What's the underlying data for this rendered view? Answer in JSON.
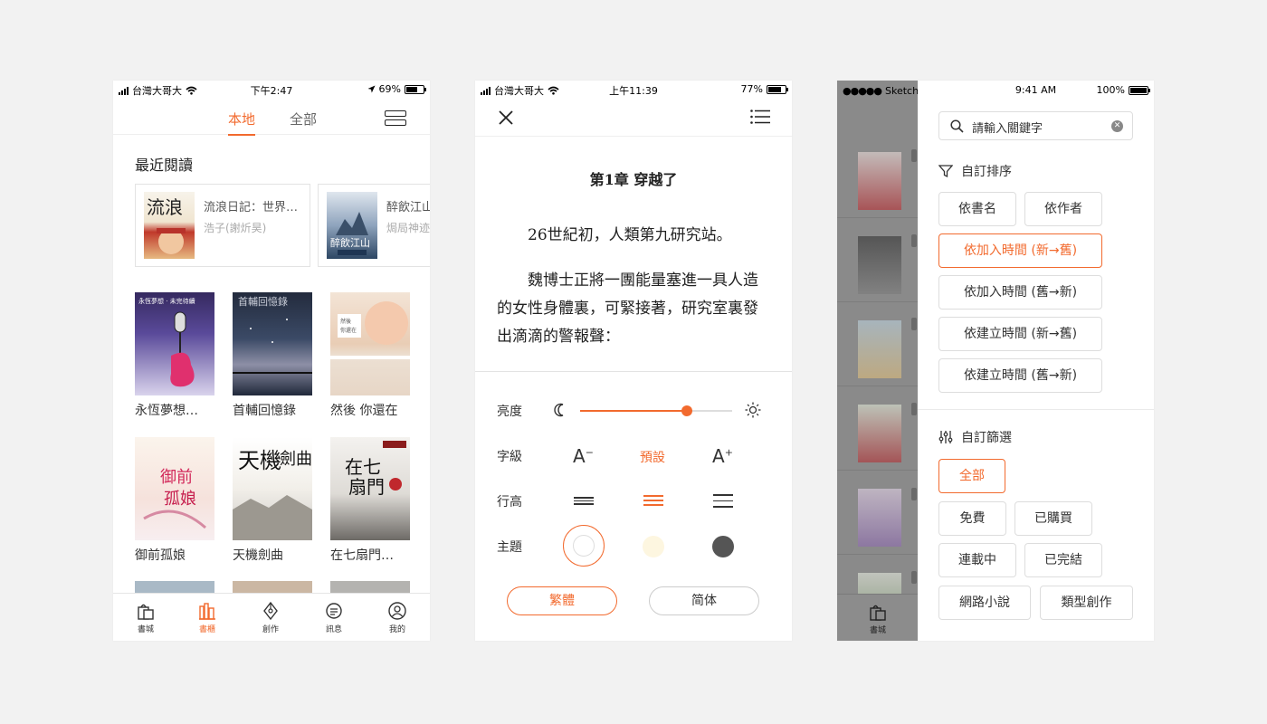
{
  "colors": {
    "accent": "#f26a2e"
  },
  "screen1": {
    "status": {
      "carrier": "台灣大哥大",
      "time": "下午2:47",
      "battery": "69%"
    },
    "tabs": [
      {
        "label": "本地",
        "active": true
      },
      {
        "label": "全部",
        "active": false
      }
    ],
    "recent_title": "最近閱讀",
    "recent": [
      {
        "title": "流浪日記：世界…",
        "author": "浩子(謝炘昊)"
      },
      {
        "title": "醉飲江山",
        "author": "焗局神迹"
      }
    ],
    "books": [
      {
        "title": "永恆夢想…"
      },
      {
        "title": "首輔回憶錄"
      },
      {
        "title": "然後 你還在"
      },
      {
        "title": "御前孤娘"
      },
      {
        "title": "天機劍曲"
      },
      {
        "title": "在七扇門…"
      }
    ],
    "tabbar": [
      {
        "label": "書城",
        "icon": "shopping-bag-icon",
        "active": false
      },
      {
        "label": "書櫃",
        "icon": "bookshelf-icon",
        "active": true
      },
      {
        "label": "創作",
        "icon": "pen-nib-icon",
        "active": false
      },
      {
        "label": "訊息",
        "icon": "chat-bubble-icon",
        "active": false
      },
      {
        "label": "我的",
        "icon": "user-icon",
        "active": false
      }
    ]
  },
  "screen2": {
    "status": {
      "carrier": "台灣大哥大",
      "time": "上午11:39",
      "battery": "77%"
    },
    "chapter_title": "第1章 穿越了",
    "paragraphs": [
      "26世紀初，人類第九研究站。",
      "魏博士正將一團能量塞進一具人造的女性身體裏，可緊接著，研究室裏發出滴滴的警報聲："
    ],
    "settings": {
      "brightness_label": "亮度",
      "brightness_value": 0.7,
      "font_label": "字級",
      "font_smaller": "A",
      "font_smaller_sup": "−",
      "font_default": "預設",
      "font_larger": "A",
      "font_larger_sup": "+",
      "line_height_label": "行高",
      "line_height_selected": 1,
      "theme_label": "主題",
      "theme_selected": 0,
      "themes": [
        "#ffffff",
        "#fdf6e0",
        "#555555"
      ]
    },
    "scripts": [
      {
        "label": "繁體",
        "active": true
      },
      {
        "label": "简体",
        "active": false
      }
    ]
  },
  "screen3": {
    "status": {
      "carrier": "Sketch",
      "time": "9:41 AM",
      "battery": "100%"
    },
    "search_placeholder": "請輸入關鍵字",
    "sort_title": "自訂排序",
    "sort_options": [
      {
        "label": "依書名",
        "active": false
      },
      {
        "label": "依作者",
        "active": false
      },
      {
        "label": "依加入時間 (新→舊)",
        "active": true
      },
      {
        "label": "依加入時間 (舊→新)",
        "active": false
      },
      {
        "label": "依建立時間 (新→舊)",
        "active": false
      },
      {
        "label": "依建立時間 (舊→新)",
        "active": false
      }
    ],
    "filter_title": "自訂篩選",
    "filter_options": [
      {
        "label": "全部",
        "active": true
      },
      {
        "label": "免費",
        "active": false
      },
      {
        "label": "已購買",
        "active": false
      },
      {
        "label": "連載中",
        "active": false
      },
      {
        "label": "已完結",
        "active": false
      },
      {
        "label": "網路小說",
        "active": false
      },
      {
        "label": "類型創作",
        "active": false
      }
    ],
    "background_tab_label": "書城"
  }
}
